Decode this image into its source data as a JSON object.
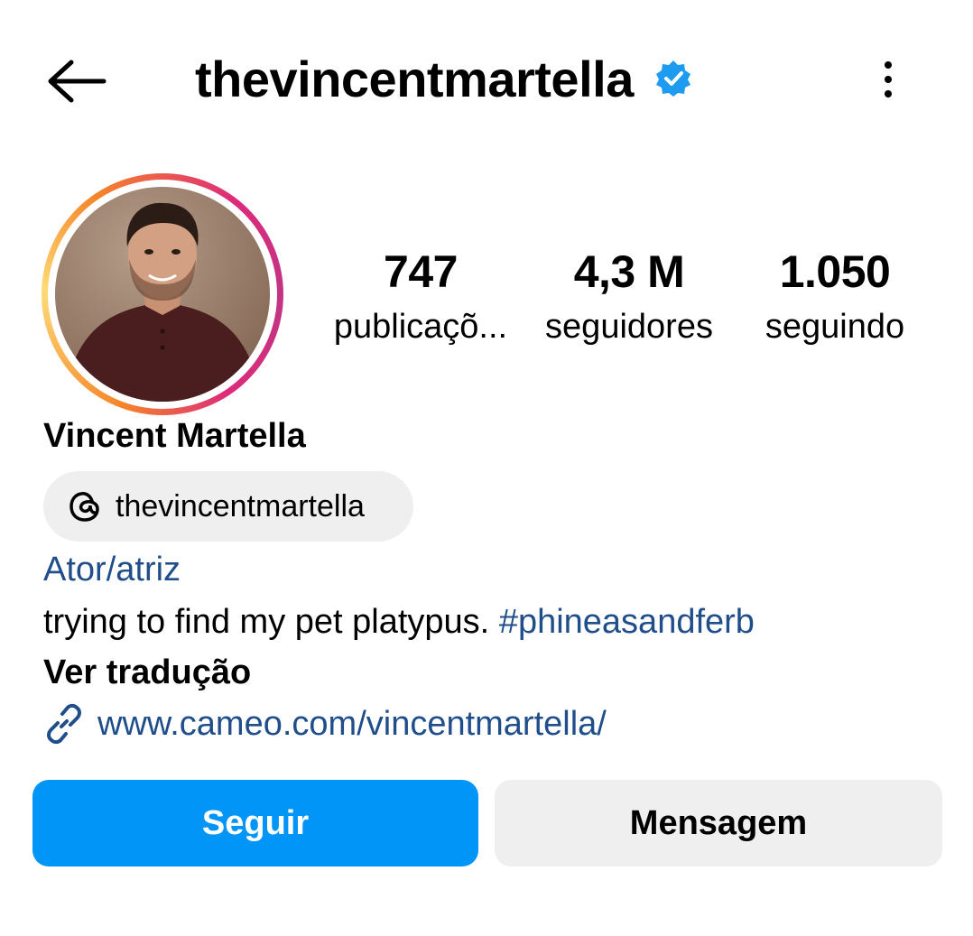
{
  "header": {
    "back_icon": "arrow-left-icon",
    "username": "thevincentmartella",
    "verified_icon": "verified-badge-icon",
    "verified_color": "#1d9bf0",
    "more_icon": "more-vertical-icon"
  },
  "profile": {
    "avatar": "profile-photo",
    "ring_colors": [
      "#f58529",
      "#feda77",
      "#dd2a7b",
      "#c13584"
    ],
    "stats": [
      {
        "value": "747",
        "label": "publicaçõ..."
      },
      {
        "value": "4,3 M",
        "label": "seguidores"
      },
      {
        "value": "1.050",
        "label": "seguindo"
      }
    ],
    "full_name": "Vincent Martella",
    "threads": {
      "icon": "threads-icon",
      "handle": "thevincentmartella"
    },
    "category": "Ator/atriz",
    "bio_text": "trying to find my pet platypus. ",
    "bio_hashtag": "#phineasandferb",
    "translate_label": "Ver tradução",
    "link": {
      "icon": "link-icon",
      "url": "www.cameo.com/vincentmartella/"
    }
  },
  "actions": {
    "follow_label": "Seguir",
    "message_label": "Mensagem",
    "follow_color": "#0095f6",
    "link_color": "#1f4e8a"
  }
}
